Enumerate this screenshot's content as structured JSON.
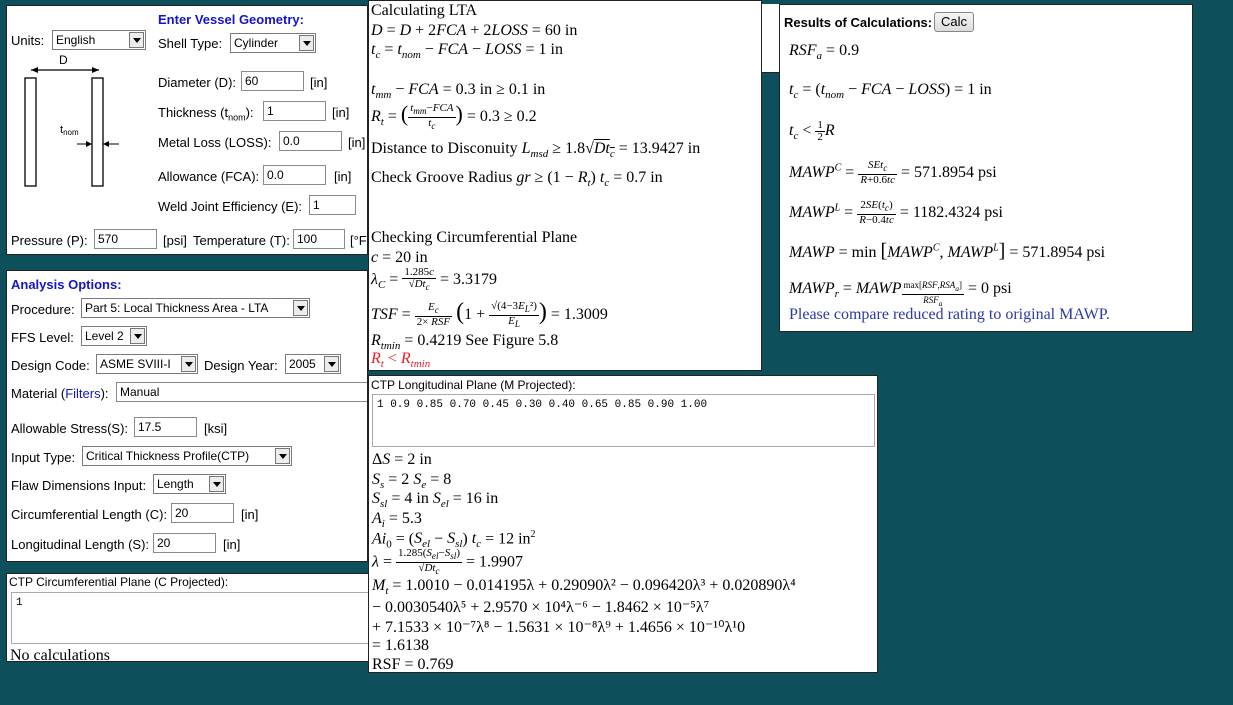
{
  "geometry": {
    "header": "Enter Vessel Geometry:",
    "units_label": "Units:",
    "units_value": "English",
    "shell_type_label": "Shell Type:",
    "shell_type_value": "Cylinder",
    "diagram_d": "D",
    "diagram_t": "t",
    "diagram_t_sub": "nom",
    "diameter_label": "Diameter (D):",
    "diameter_value": "60",
    "diameter_unit": "[in]",
    "thickness_label": "Thickness (t",
    "thickness_sub": "nom",
    "thickness_label_end": "):",
    "thickness_value": "1",
    "thickness_unit": "[in]",
    "loss_label": "Metal Loss (LOSS):",
    "loss_value": "0.0",
    "loss_unit": "[in]",
    "fca_label": "Allowance (FCA):",
    "fca_value": "0.0",
    "fca_unit": "[in]",
    "weld_label": "Weld Joint Efficiency (E):",
    "weld_value": "1",
    "pressure_label": "Pressure (P):",
    "pressure_value": "570",
    "pressure_unit": "[psi]",
    "temperature_label": "Temperature (T):",
    "temperature_value": "100",
    "temperature_unit": "[°F"
  },
  "options": {
    "header": "Analysis Options:",
    "procedure_label": "Procedure:",
    "procedure_value": "Part 5: Local Thickness Area - LTA",
    "ffs_label": "FFS Level:",
    "ffs_value": "Level 2",
    "code_label": "Design Code:",
    "code_value": "ASME SVIII-I",
    "year_label": "Design Year:",
    "year_value": "2005",
    "material_label": "Material (",
    "material_link": "Filters",
    "material_label_end": "):",
    "material_value": "Manual",
    "stress_label": "Allowable Stress(S):",
    "stress_value": "17.5",
    "stress_unit": "[ksi]",
    "input_type_label": "Input Type:",
    "input_type_value": "Critical Thickness Profile(CTP)",
    "flaw_label": "Flaw Dimensions Input:",
    "flaw_value": "Length",
    "circ_label": "Circumferential Length (C):",
    "circ_value": "20",
    "circ_unit": "[in]",
    "long_label": "Longitudinal Length (S):",
    "long_value": "20",
    "long_unit": "[in]"
  },
  "ctp_circ": {
    "title": "CTP Circumferential Plane (C Projected):",
    "value": "1",
    "status": "No calculations"
  },
  "lta": {
    "title": "Calculating LTA",
    "d_result": "= 60 in",
    "tc_result": "= 1 in",
    "tmm_result": "= 0.3 in ≥ 0.1 in",
    "rt_result": "= 0.3 ≥ 0.2",
    "dist_label": "Distance to Disconuity",
    "dist_result": "= 13.9427 in",
    "groove_label": "Check Groove Radius",
    "groove_result": "= 0.7 in",
    "circ_title": "Checking Circumferential Plane",
    "c_line": "= 20 in",
    "lambda_c_result": "= 3.3179",
    "tsf_result": "= 1.3009",
    "rtmin_result": "= 0.4219 See Figure 5.8",
    "warn": "R"
  },
  "ctp_long": {
    "title": "CTP Longitudinal Plane (M Projected):",
    "value": "1 0.9 0.85 0.70 0.45 0.30 0.40 0.65 0.85 0.90 1.00",
    "ds": "= 2 in",
    "ss_se": "= 2",
    "se_val": "= 8",
    "ssl_val": "= 4 in",
    "sel_val": "= 16 in",
    "ai_val": "= 5.3",
    "ai0_val": "= 12 in",
    "lambda_val": "= 1.9907",
    "mt_line1": "= 1.0010 − 0.014195λ + 0.29090λ² − 0.096420λ³ + 0.020890λ⁴",
    "mt_line2": "− 0.0030540λ⁵ + 2.9570 × 10⁴λ⁻⁶ − 1.8462 × 10⁻⁵λ⁷",
    "mt_line3": "+ 7.1533 × 10⁻⁷λ⁸ − 1.5631 × 10⁻⁸λ⁹ + 1.4656 × 10⁻¹⁰λ¹0",
    "mt_line4": "= 1.6138",
    "rsf_line": "RSF = 0.769"
  },
  "results": {
    "header": "Results of Calculations:",
    "calc_button": "Calc",
    "rsfa": "= 0.9",
    "tc": "= 1 in",
    "mawpc": "= 571.8954  psi",
    "mawpl": "= 1182.4324  psi",
    "mawp": "= 571.8954  psi",
    "mawpr": "= 0  psi",
    "note": "Please compare reduced rating to original MAWP."
  }
}
